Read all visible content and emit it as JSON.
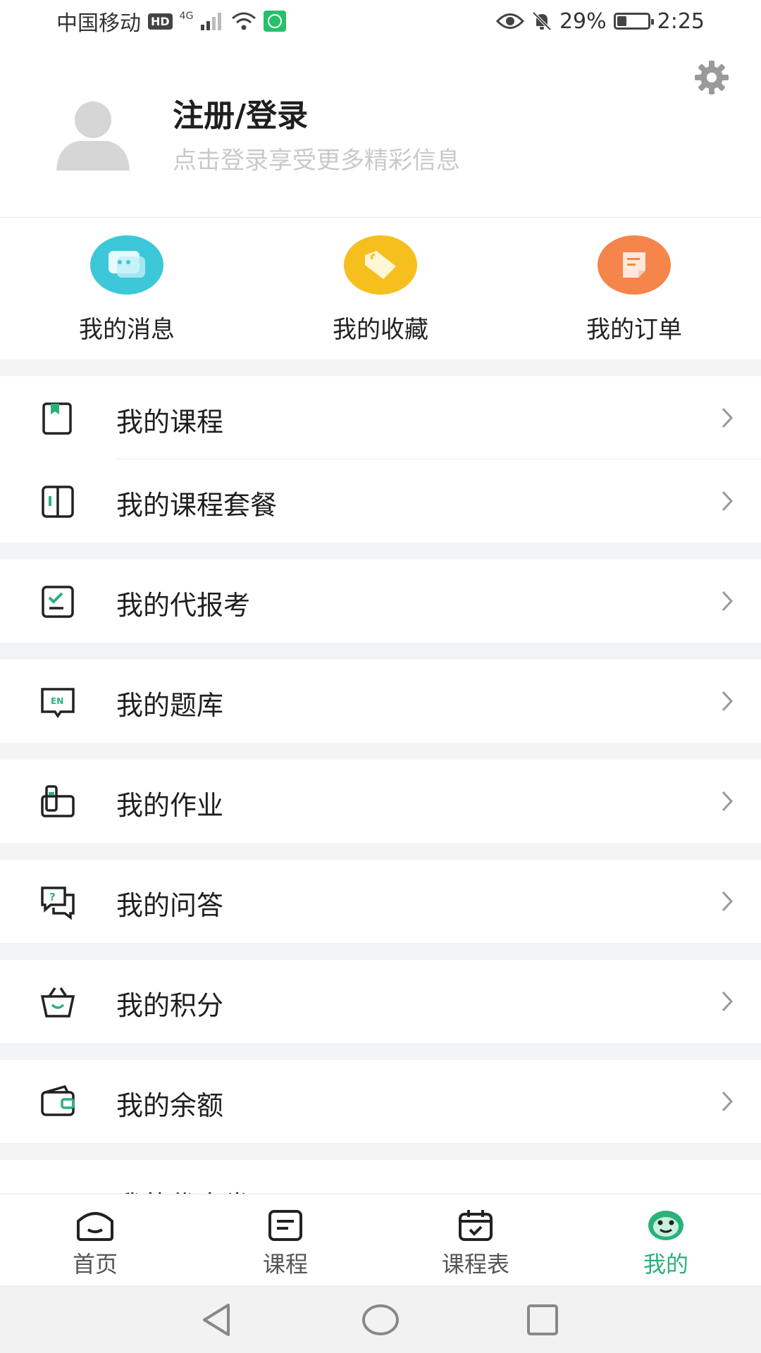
{
  "status_bar": {
    "carrier": "中国移动",
    "hd_badge": "HD",
    "network": "4G",
    "battery_percent": "29%",
    "battery_level": 0.29,
    "time": "2:25"
  },
  "header": {
    "title": "注册/登录",
    "subtitle": "点击登录享受更多精彩信息"
  },
  "quick_actions": [
    {
      "label": "我的消息",
      "icon": "message-icon",
      "color": "#3cc8d8"
    },
    {
      "label": "我的收藏",
      "icon": "tag-icon",
      "color": "#f5bf1e"
    },
    {
      "label": "我的订单",
      "icon": "order-icon",
      "color": "#f5854a"
    }
  ],
  "menu": {
    "items": [
      {
        "label": "我的课程",
        "icon": "bookmark-book-icon"
      },
      {
        "label": "我的课程套餐",
        "icon": "open-book-icon"
      },
      {
        "label": "我的代报考",
        "icon": "checklist-icon"
      },
      {
        "label": "我的题库",
        "icon": "en-book-icon"
      },
      {
        "label": "我的作业",
        "icon": "homework-icon"
      },
      {
        "label": "我的问答",
        "icon": "question-chat-icon"
      },
      {
        "label": "我的积分",
        "icon": "basket-icon"
      },
      {
        "label": "我的余额",
        "icon": "wallet-icon"
      },
      {
        "label": "我的优惠券",
        "icon": "coupon-icon"
      }
    ]
  },
  "tabs": [
    {
      "label": "首页",
      "icon": "home-icon",
      "active": false
    },
    {
      "label": "课程",
      "icon": "course-icon",
      "active": false
    },
    {
      "label": "课程表",
      "icon": "calendar-icon",
      "active": false
    },
    {
      "label": "我的",
      "icon": "profile-face-icon",
      "active": true
    }
  ],
  "colors": {
    "accent": "#2ab27b",
    "icon_green": "#2ab27b",
    "icon_dark": "#222222",
    "section_gap": "#f3f4f6"
  }
}
